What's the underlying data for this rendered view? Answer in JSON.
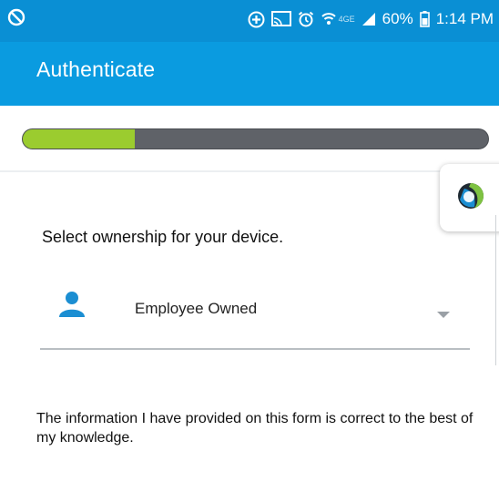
{
  "status_bar": {
    "icons": [
      "blocked-icon",
      "add-circle-icon",
      "cast-icon",
      "alarm-icon",
      "wifi-icon",
      "signal-icon",
      "battery-icon"
    ],
    "network_label": "4GE",
    "battery_percent": "60%",
    "time": "1:14 PM"
  },
  "app_bar": {
    "title": "Authenticate"
  },
  "progress": {
    "fraction": 0.24
  },
  "form": {
    "prompt": "Select ownership for your device.",
    "ownership_value": "Employee Owned",
    "disclaimer": "The information I have provided on this form is correct to the best of my knowledge."
  },
  "colors": {
    "status_bar": "#0a8fd4",
    "app_bar": "#0a9be0",
    "progress_fill": "#9bcc2f",
    "progress_track": "#5f6268",
    "accent_icon": "#1b8ed2"
  }
}
